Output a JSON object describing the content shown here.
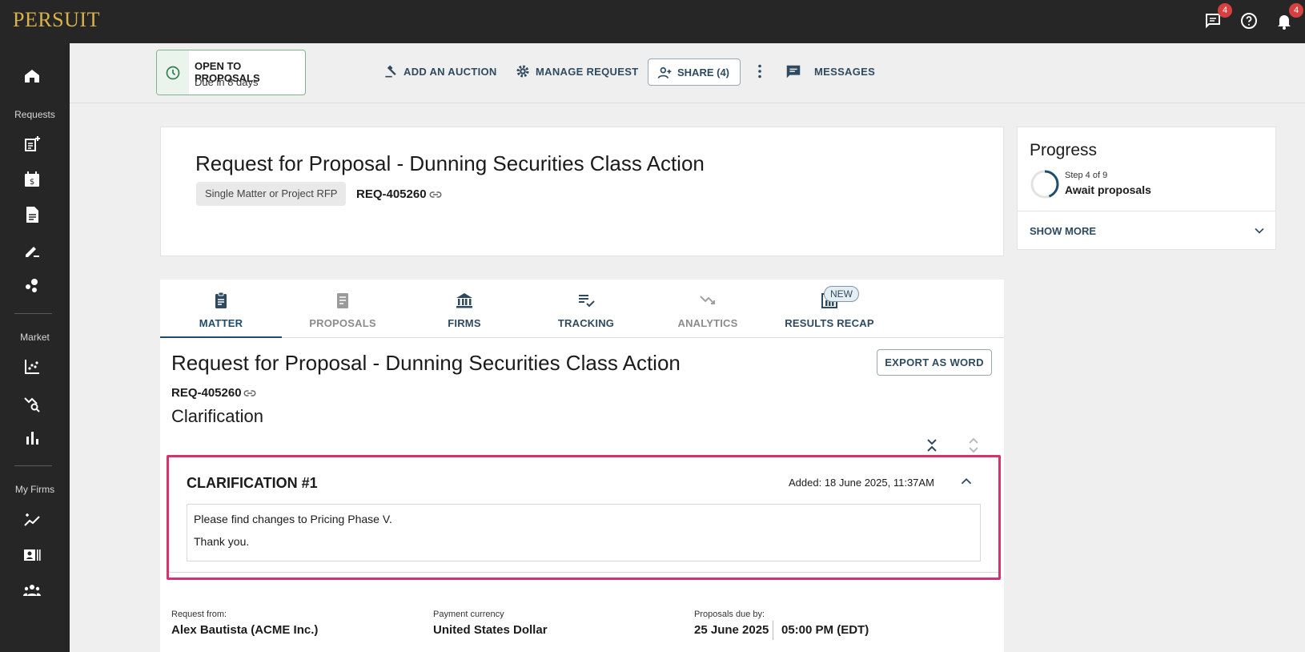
{
  "app": {
    "logo": "PERSUIT",
    "messages_badge": "4",
    "notifications_badge": "4"
  },
  "sidenav": {
    "section_requests": "Requests",
    "section_market": "Market",
    "section_my_firms": "My Firms"
  },
  "actionbar": {
    "status_title": "OPEN TO PROPOSALS",
    "status_sub": "Due in 8 days",
    "add_auction": "ADD AN AUCTION",
    "manage_request": "MANAGE REQUEST",
    "share": "SHARE (4)",
    "messages": "MESSAGES"
  },
  "header": {
    "title": "Request for Proposal - Dunning Securities Class Action",
    "type_chip": "Single Matter or Project RFP",
    "request_id": "REQ-405260"
  },
  "progress": {
    "title": "Progress",
    "step": "Step 4 of 9",
    "step_name": "Await proposals",
    "fraction": 0.444,
    "show_more": "SHOW MORE"
  },
  "tabs": [
    {
      "label": "MATTER",
      "icon": "clipboard-icon",
      "active": true
    },
    {
      "label": "PROPOSALS",
      "icon": "document-icon",
      "active": false
    },
    {
      "label": "FIRMS",
      "icon": "bank-icon",
      "active": false
    },
    {
      "label": "TRACKING",
      "icon": "checklist-icon",
      "active": false
    },
    {
      "label": "ANALYTICS",
      "icon": "trending-down-icon",
      "active": false
    },
    {
      "label": "RESULTS RECAP",
      "icon": "results-icon",
      "active": false,
      "badge": "NEW"
    }
  ],
  "content": {
    "title": "Request for Proposal - Dunning Securities Class Action",
    "export": "EXPORT AS WORD",
    "request_id": "REQ-405260",
    "section": "Clarification",
    "clarification": {
      "title": "CLARIFICATION #1",
      "added": "Added: 18 June 2025, 11:37AM",
      "lines": [
        "Please find changes to Pricing Phase V.",
        "Thank you."
      ]
    },
    "meta": {
      "request_from_label": "Request from:",
      "request_from": "Alex Bautista (ACME Inc.)",
      "currency_label": "Payment currency",
      "currency": "United States Dollar",
      "due_label": "Proposals due by:",
      "due_date": "25 June 2025",
      "due_time": "05:00 PM (EDT)"
    }
  },
  "colors": {
    "topbar": "#262626",
    "accent": "#1f4d6b",
    "highlight": "#d6336c",
    "logo": "#d9b24c",
    "badge": "#d64040"
  }
}
